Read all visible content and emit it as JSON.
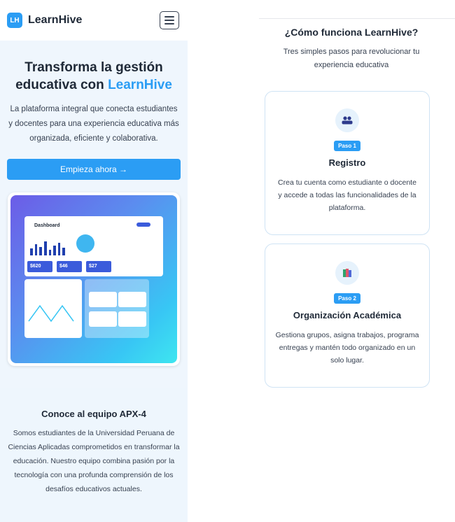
{
  "nav": {
    "logo_initials": "LH",
    "brand": "LearnHive",
    "menu_icon": "hamburger-menu-icon"
  },
  "hero": {
    "title_part1": "Transforma la gestión educativa con",
    "title_accent": "LearnHive",
    "description": "La plataforma integral que conecta estudiantes y docentes para una experiencia educativa más organizada, eficiente y colaborativa.",
    "cta_label": "Empieza ahora →"
  },
  "dashboard_mockup": {
    "title": "Dashboard",
    "stats": [
      "$620",
      "$46",
      "$27"
    ]
  },
  "team": {
    "title": "Conoce al equipo APX-4",
    "description": "Somos estudiantes de la Universidad Peruana de Ciencias Aplicadas comprometidos en transformar la educación. Nuestro equipo combina pasión por la tecnología con una profunda comprensión de los desafíos educativos actuales."
  },
  "how": {
    "title": "¿Cómo funciona LearnHive?",
    "subtitle": "Tres simples pasos para revolucionar tu experiencia educativa",
    "steps": [
      {
        "icon": "users-icon",
        "badge": "Paso 1",
        "title": "Registro",
        "description": "Crea tu cuenta como estudiante o docente y accede a todas las funcionalidades de la plataforma."
      },
      {
        "icon": "books-icon",
        "badge": "Paso 2",
        "title": "Organización Académica",
        "description": "Gestiona grupos, asigna trabajos, programa entregas y mantén todo organizado en un solo lugar."
      }
    ]
  },
  "colors": {
    "accent": "#2b9df4",
    "text": "#1f2937",
    "panel_bg": "#eff6fd"
  }
}
